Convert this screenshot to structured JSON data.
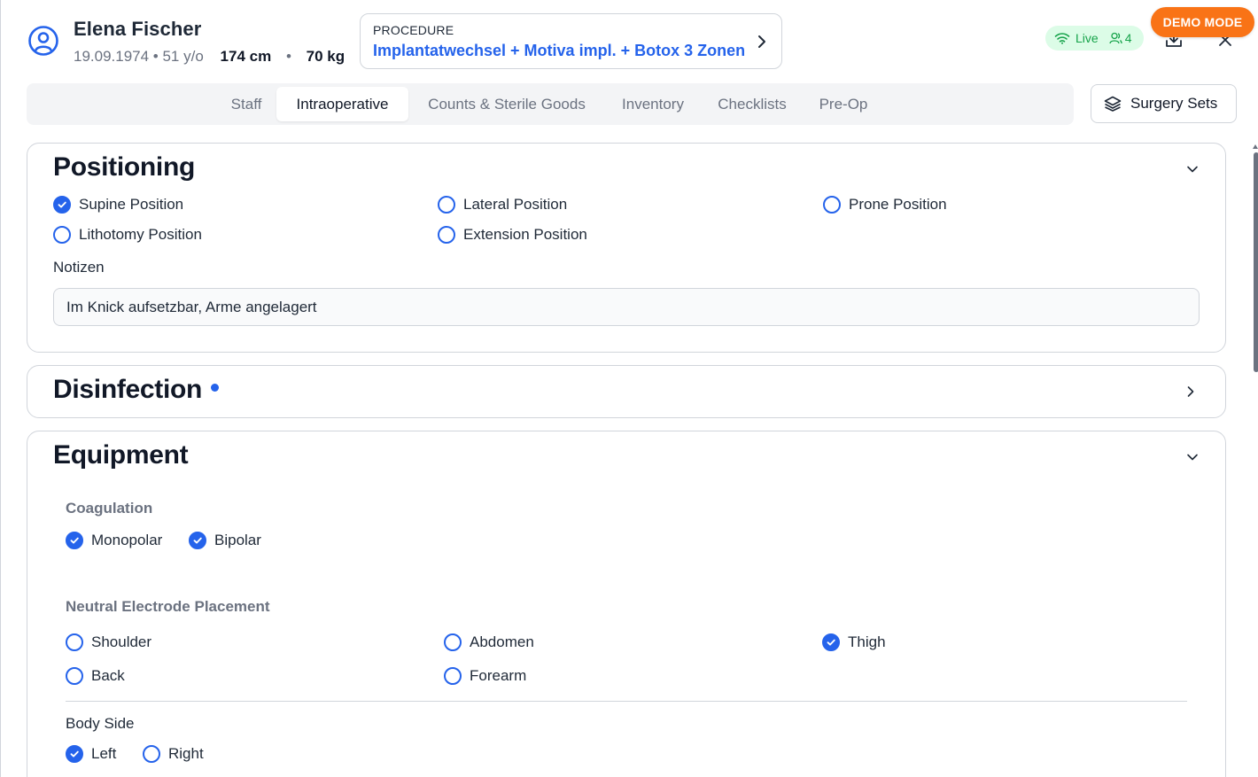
{
  "patient": {
    "name": "Elena Fischer",
    "dob_age": "19.09.1974 • 51 y/o",
    "height": "174 cm",
    "separator": "•",
    "weight": "70 kg"
  },
  "procedure": {
    "label": "PROCEDURE",
    "value": "Implantatwechsel + Motiva impl. + Botox 3 Zonen"
  },
  "status": {
    "live_label": "Live",
    "users_count": "4",
    "demo_label": "DEMO MODE"
  },
  "tabs": [
    {
      "label": "Staff"
    },
    {
      "label": "Intraoperative"
    },
    {
      "label": "Counts & Sterile Goods"
    },
    {
      "label": "Inventory"
    },
    {
      "label": "Checklists"
    },
    {
      "label": "Pre-Op"
    }
  ],
  "active_tab": "Intraoperative",
  "surgery_sets_label": "Surgery Sets",
  "positioning": {
    "title": "Positioning",
    "options": [
      {
        "label": "Supine Position",
        "checked": true
      },
      {
        "label": "Lateral Position",
        "checked": false
      },
      {
        "label": "Prone Position",
        "checked": false
      },
      {
        "label": "Lithotomy Position",
        "checked": false
      },
      {
        "label": "Extension Position",
        "checked": false
      }
    ],
    "notes_label": "Notizen",
    "notes_value": "Im Knick aufsetzbar, Arme angelagert"
  },
  "disinfection": {
    "title": "Disinfection"
  },
  "equipment": {
    "title": "Equipment",
    "coagulation_label": "Coagulation",
    "coagulation": [
      {
        "label": "Monopolar",
        "checked": true
      },
      {
        "label": "Bipolar",
        "checked": true
      }
    ],
    "electrode_label": "Neutral Electrode Placement",
    "electrode": [
      {
        "label": "Shoulder",
        "checked": false
      },
      {
        "label": "Abdomen",
        "checked": false
      },
      {
        "label": "Thigh",
        "checked": true
      },
      {
        "label": "Back",
        "checked": false
      },
      {
        "label": "Forearm",
        "checked": false
      }
    ],
    "body_side_label": "Body Side",
    "body_side": [
      {
        "label": "Left",
        "checked": true
      },
      {
        "label": "Right",
        "checked": false
      }
    ]
  },
  "colors": {
    "accent": "#2563eb",
    "live_green": "#16a34a",
    "demo_orange": "#f97316"
  }
}
